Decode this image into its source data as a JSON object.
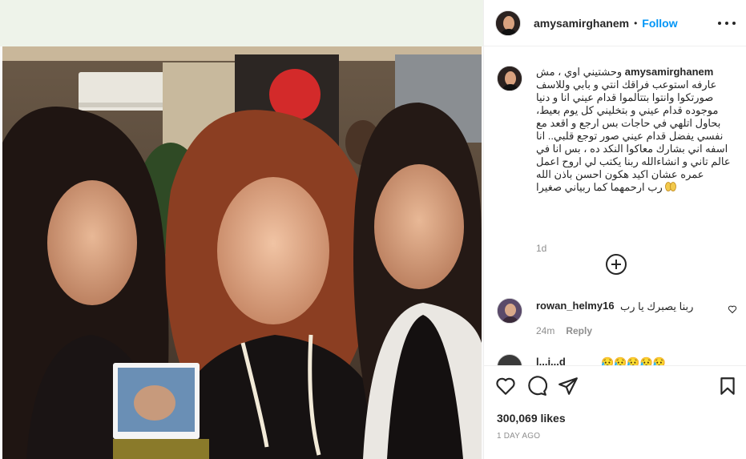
{
  "post": {
    "username": "amysamirghanem",
    "separator": "•",
    "follow_label": "Follow",
    "more_icon": "more-horizontal-icon"
  },
  "caption": {
    "username": "amysamirghanem",
    "lines": [
      "وحشتيني اوي ، مش",
      "عارفه استوعب فراقك انتي و بابي وللاسف",
      "صورتكوا وانتوا بتتألموا قدام عيني انا و دنيا",
      "موجوده قدام عيني و بتخليني كل يوم بعيط،",
      "بحاول اتلهي في حاجات بس ارجع و اقعد مع",
      "نفسي يفضل قدام عيني صور توجع قلبي.. انا",
      "اسفه اني بشارك معاكوا النكد ده ، بس انا في",
      "عالم تاني و انشاءالله ربنا يكتب لي اروح اعمل",
      "عمره عشان اكيد هكون احسن باذن الله",
      "رب ارحمهما كما ربياني صغيرا"
    ],
    "emoji": "praying-hands",
    "time": "1d"
  },
  "load_more_icon": "plus-circle-icon",
  "comments": [
    {
      "username": "rowan_helmy16",
      "text": "ربنا يصبرك يا رب",
      "time": "24m",
      "reply_label": "Reply"
    },
    {
      "username": "l...i...d",
      "text": "😥😥😥😥😥",
      "time": "",
      "reply_label": ""
    }
  ],
  "actions": {
    "like_icon": "heart-icon",
    "comment_icon": "comment-icon",
    "share_icon": "paper-plane-icon",
    "save_icon": "bookmark-icon"
  },
  "likes": "300,069 likes",
  "post_time": "1 DAY AGO",
  "colors": {
    "accent": "#0095f6",
    "text": "#262626",
    "muted": "#8e8e8e",
    "border": "#efefef"
  }
}
